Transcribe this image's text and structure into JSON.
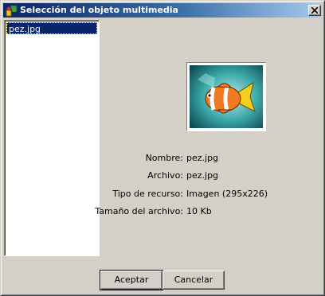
{
  "window": {
    "title": "Selección del objeto multimedia"
  },
  "file_list": {
    "items": [
      {
        "label": "pez.jpg",
        "selected": true
      }
    ]
  },
  "preview": {
    "image": "clownfish-icon"
  },
  "details": {
    "nombre": {
      "label": "Nombre:",
      "value": "pez.jpg"
    },
    "archivo": {
      "label": "Archivo:",
      "value": "pez.jpg"
    },
    "tipo": {
      "label": "Tipo de recurso:",
      "value": "Imagen (295x226)"
    },
    "tamano": {
      "label": "Tamaño del archivo:",
      "value": "10 Kb"
    }
  },
  "buttons": {
    "ok": "Aceptar",
    "cancel": "Cancelar"
  },
  "colors": {
    "titlebar_start": "#0a246a",
    "titlebar_end": "#a6caf0",
    "face": "#d4d0c8",
    "selection": "#0a246a"
  }
}
